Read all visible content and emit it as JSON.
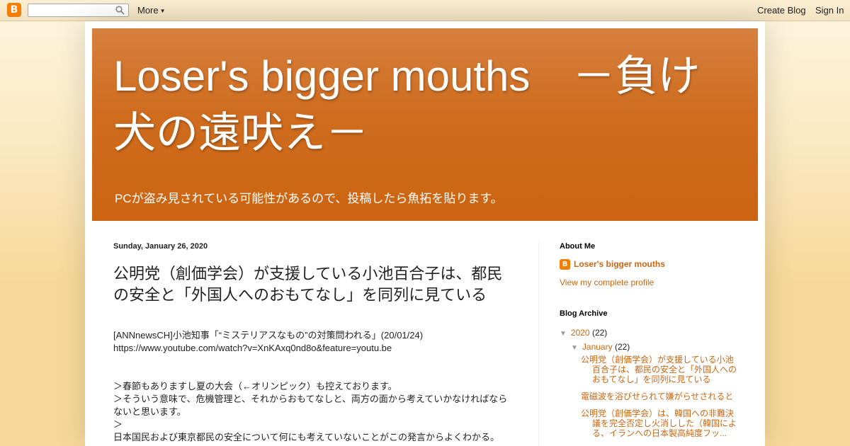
{
  "navbar": {
    "logo": "B",
    "search_placeholder": "",
    "more_label": "More",
    "create_blog_label": "Create Blog",
    "sign_in_label": "Sign In"
  },
  "header": {
    "title": "Loser's bigger mouths　－負け犬の遠吠え－",
    "description": "PCが盗み見されている可能性があるので、投稿したら魚拓を貼ります。"
  },
  "post": {
    "date": "Sunday, January 26, 2020",
    "title": "公明党（創価学会）が支援している小池百合子は、都民の安全と「外国人へのおもてなし」を同列に見ている",
    "body": [
      "[ANNnewsCH]小池知事「“ミステリアスなもの”の対策問われる」(20/01/24)",
      "https://www.youtube.com/watch?v=XnKAxq0nd8o&feature=youtu.be",
      "＞春節もありますし夏の大会（←オリンピック）も控えております。",
      "＞そういう意味で、危機管理と、それからおもてなしと、両方の面から考えていかなければならないと思います。",
      "＞",
      "日本国民および東京都民の安全について何にも考えていないことがこの発言からよくわかる。"
    ]
  },
  "sidebar": {
    "about_heading": "About Me",
    "profile_icon": "B",
    "profile_name": "Loser's bigger mouths",
    "profile_link": "View my complete profile",
    "archive_heading": "Blog Archive",
    "archive_year": "2020",
    "archive_year_count": "(22)",
    "archive_month": "January",
    "archive_month_count": "(22)",
    "archive_posts": [
      "公明党（創価学会）が支援している小池百合子は、都民の安全と「外国人へのおもてなし」を同列に見ている",
      "電磁波を浴びせられて嫌がらせされると",
      "公明党（創価学会）は、韓国への非難決議を完全否定し火消しした（韓国による、イランへの日本製高純度フッ..."
    ]
  },
  "colors": {
    "accent": "#cc6611",
    "header_bg": "#cc6511",
    "page_bg": "#f6d99a",
    "blogger_orange": "#f57d00"
  },
  "icons": {
    "blogger_logo": "blogger-logo-icon",
    "search": "search-icon",
    "collapse": "triangle-down-icon"
  }
}
